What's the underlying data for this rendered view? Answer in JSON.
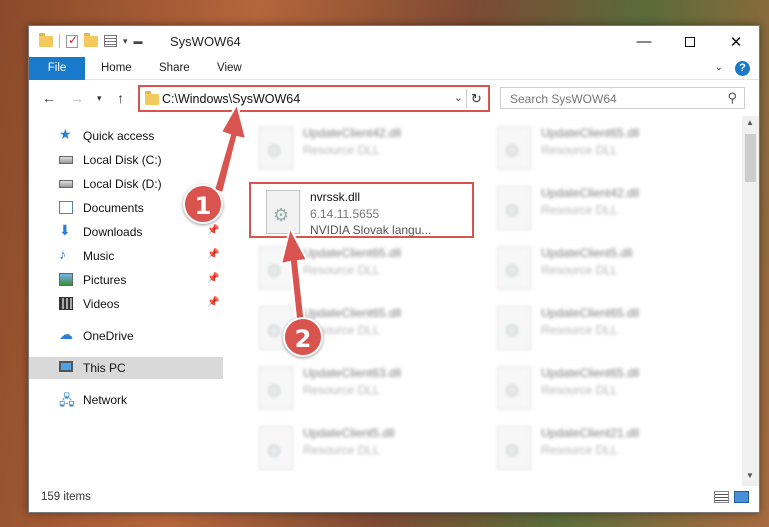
{
  "window": {
    "title": "SysWOW64",
    "minimize_glyph": "—",
    "close_glyph": "✕"
  },
  "ribbon": {
    "tabs": [
      "File",
      "Home",
      "Share",
      "View"
    ],
    "help_glyph": "?"
  },
  "address_bar": {
    "path": "C:\\Windows\\SysWOW64"
  },
  "search": {
    "placeholder": "Search SysWOW64"
  },
  "sidebar": {
    "items": [
      {
        "label": "Quick access",
        "icon": "star-icon",
        "pinned": false
      },
      {
        "label": "Local Disk (C:)",
        "icon": "disk-icon",
        "pinned": false
      },
      {
        "label": "Local Disk (D:)",
        "icon": "disk-icon",
        "pinned": false
      },
      {
        "label": "Documents",
        "icon": "documents-icon",
        "pinned": true
      },
      {
        "label": "Downloads",
        "icon": "download-icon",
        "pinned": true
      },
      {
        "label": "Music",
        "icon": "music-icon",
        "pinned": true
      },
      {
        "label": "Pictures",
        "icon": "pictures-icon",
        "pinned": true
      },
      {
        "label": "Videos",
        "icon": "videos-icon",
        "pinned": true
      },
      {
        "label": "OneDrive",
        "icon": "cloud-icon",
        "pinned": false
      },
      {
        "label": "This PC",
        "icon": "computer-icon",
        "pinned": false,
        "selected": true
      },
      {
        "label": "Network",
        "icon": "network-icon",
        "pinned": false
      }
    ]
  },
  "files": {
    "left": [
      {
        "name": "UpdateClient42.dll",
        "desc": "Resource DLL"
      },
      {
        "name": "nvrssk.dll",
        "version": "6.14.11.5655",
        "desc": "NVIDIA Slovak langu...",
        "highlighted": true
      },
      {
        "name": "UpdateClient65.dll",
        "desc": "Resource DLL"
      },
      {
        "name": "UpdateClient65.dll",
        "desc": "Resource DLL"
      },
      {
        "name": "UpdateClient63.dll",
        "desc": "Resource DLL"
      },
      {
        "name": "UpdateClient5.dll",
        "desc": "Resource DLL"
      }
    ],
    "right": [
      {
        "name": "UpdateClient65.dll",
        "desc": "Resource DLL"
      },
      {
        "name": "UpdateClient42.dll",
        "desc": "Resource DLL"
      },
      {
        "name": "UpdateClient5.dll",
        "desc": "Resource DLL"
      },
      {
        "name": "UpdateClient65.dll",
        "desc": "Resource DLL"
      },
      {
        "name": "UpdateClient65.dll",
        "desc": "Resource DLL"
      },
      {
        "name": "UpdateClient21.dll",
        "desc": "Resource DLL"
      }
    ]
  },
  "status": {
    "item_count": "159 items"
  },
  "annotations": {
    "badge_1": "1",
    "badge_2": "2",
    "color": "#d9534f"
  }
}
